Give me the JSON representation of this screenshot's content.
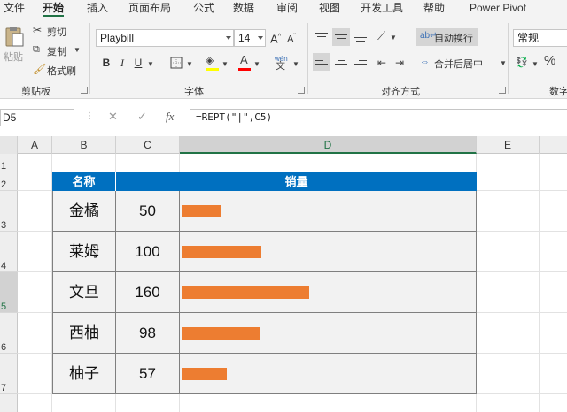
{
  "menu": [
    "文件",
    "开始",
    "插入",
    "页面布局",
    "公式",
    "数据",
    "审阅",
    "视图",
    "开发工具",
    "帮助",
    "Power Pivot"
  ],
  "active_menu_index": 1,
  "ribbon": {
    "clipboard": {
      "paste": "粘贴",
      "cut": "剪切",
      "copy": "复制",
      "format_painter": "格式刷",
      "group_label": "剪贴板"
    },
    "font": {
      "font_name": "Playbill",
      "font_size": "14",
      "bold": "B",
      "italic": "I",
      "underline": "U",
      "grow": "A",
      "shrink": "A",
      "wen": "文",
      "group_label": "字体"
    },
    "alignment": {
      "wrap_text": "自动换行",
      "merge_center": "合并后居中",
      "group_label": "对齐方式"
    },
    "number": {
      "format": "常规",
      "percent": "%",
      "group_label": "数字"
    }
  },
  "formula_bar": {
    "name_box": "D5",
    "formula": "=REPT(\"|\",C5)",
    "fx": "fx"
  },
  "columns": [
    "A",
    "B",
    "C",
    "D",
    "E"
  ],
  "rows": [
    "1",
    "2",
    "3",
    "4",
    "5",
    "6",
    "7"
  ],
  "table": {
    "header_name": "名称",
    "header_sales": "销量",
    "rows": [
      {
        "name": "金橘",
        "value": "50",
        "bar": 50
      },
      {
        "name": "莱姆",
        "value": "100",
        "bar": 100
      },
      {
        "name": "文旦",
        "value": "160",
        "bar": 160
      },
      {
        "name": "西柚",
        "value": "98",
        "bar": 98
      },
      {
        "name": "柚子",
        "value": "57",
        "bar": 57
      }
    ],
    "bar_color": "#ed7d31",
    "header_color": "#0070c0"
  },
  "colors": {
    "accent": "#217346",
    "header_fill": "#0070c0",
    "bar": "#ed7d31",
    "cell_fill": "#f2f2f2"
  }
}
